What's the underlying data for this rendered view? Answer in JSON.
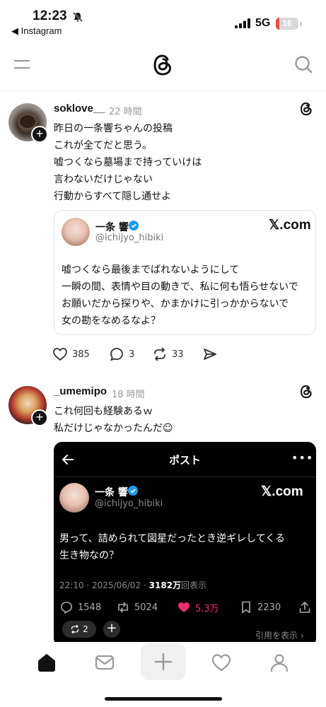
{
  "status_bar": {
    "time": "12:23",
    "back_app": "◀ Instagram",
    "network": "5G",
    "battery": "16",
    "battery_level": 0.16
  },
  "posts": [
    {
      "username": "soklove__",
      "timestamp": "22 時間",
      "lines": [
        "昨日の一条響ちゃんの投稿",
        "これが全てだと思う。",
        "嘘つくなら墓場まで持っていけは",
        "言わないだけじゃない",
        "行動からすべて隠し通せよ"
      ],
      "quote": {
        "name": "一条 響",
        "handle": "@ichijyo_hibiki",
        "source": "𝕏.com",
        "lines": [
          "嘘つくなら最後までばれないようにして",
          "一瞬の間、表情や目の動きで、私に何も悟らせないで",
          "お願いだから探りや、かまかけに引っかからないで",
          "女の勘をなめるなよ？"
        ]
      },
      "actions": {
        "likes": "385",
        "comments": "3",
        "reposts": "33"
      }
    },
    {
      "username": "_umemipo",
      "timestamp": "18 時間",
      "lines": [
        "これ何回も経験あるｗ",
        "私だけじゃなかったんだ☺"
      ],
      "embed": {
        "title": "ポスト",
        "more": "•••",
        "name": "一条 響",
        "handle": "@ichijyo_hibiki",
        "source": "𝕏.com",
        "lines": [
          "男って、詰められて図星だったとき逆ギレしてくる",
          "生き物なの？"
        ],
        "meta_time": "22:10 · 2025/06/02 · ",
        "meta_views": "3182万",
        "meta_views_suffix": "回表示",
        "stats": {
          "replies": "1548",
          "retweets": "5024",
          "likes": "5.3万",
          "bookmarks": "2230"
        },
        "repost_count": "2",
        "quote_link": "引用を表示 ›"
      }
    }
  ],
  "colors": {
    "like_pink": "#e8306e",
    "verified_blue": "#1d9bf0",
    "battery_red": "#e24a4a"
  }
}
